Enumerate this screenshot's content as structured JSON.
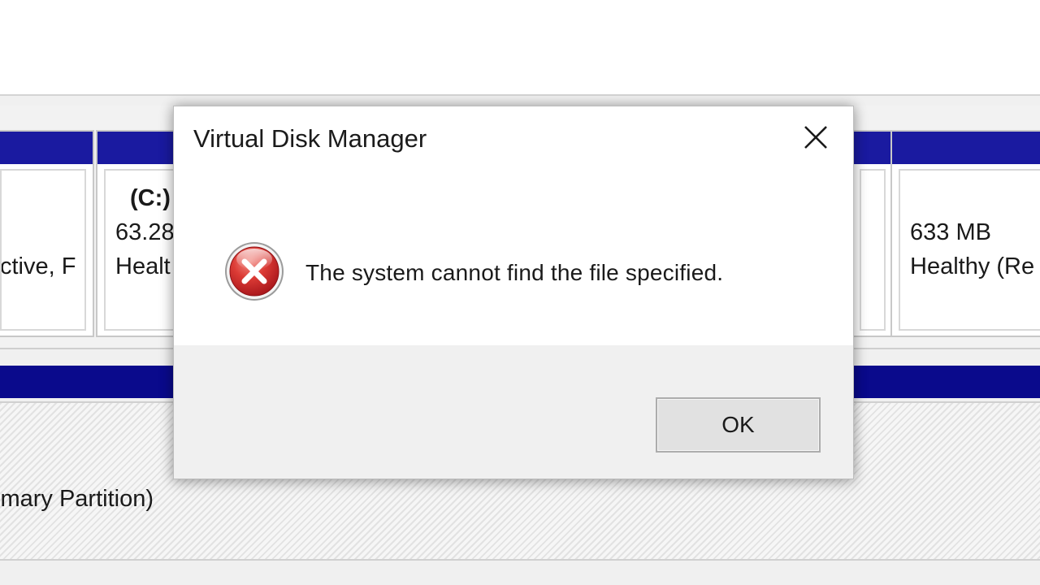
{
  "background": {
    "partitions": [
      {
        "line1": "",
        "line2": "",
        "line3": "ctive, F",
        "bar_color": "#1a1aa0"
      },
      {
        "line1": "(C:)",
        "line2": "63.28",
        "line3": "Healt",
        "bar_color": "#1a1aa0"
      },
      {
        "line1": "",
        "line2": "633 MB",
        "line3": "Healthy (Re",
        "bar_color": "#1a1aa0"
      }
    ],
    "row2_text": "imary Partition)",
    "row2_bar_color": "#0a0a8c"
  },
  "dialog": {
    "title": "Virtual Disk Manager",
    "close_icon": "close-icon",
    "error_icon": "error-icon",
    "error_color": "#d8332f",
    "message": "The system cannot find the file specified.",
    "ok_label": "OK"
  }
}
